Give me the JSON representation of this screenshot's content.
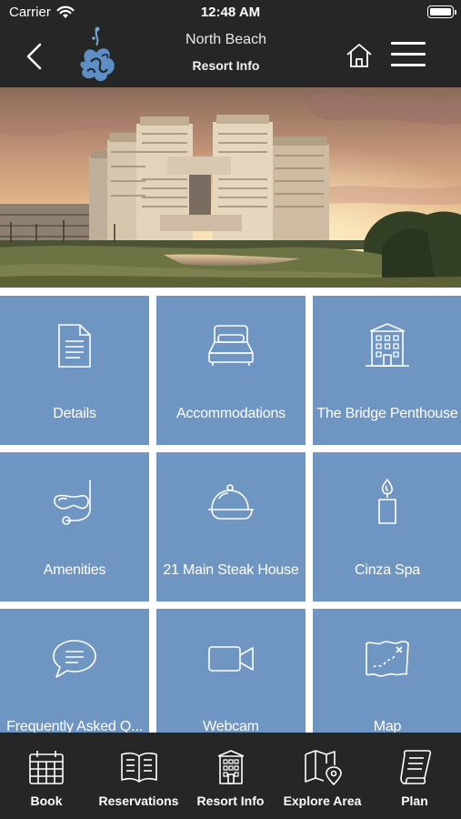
{
  "status_bar": {
    "carrier": "Carrier",
    "time": "12:48 AM"
  },
  "nav": {
    "title": "North Beach",
    "subtitle": "Resort Info",
    "icons": [
      "back-chevron-icon",
      "resort-logo",
      "home-icon",
      "hamburger-menu-icon"
    ]
  },
  "hero": {
    "description_icon": "resort-photo"
  },
  "tiles": [
    {
      "label": "Details",
      "icon": "document-icon"
    },
    {
      "label": "Accommodations",
      "icon": "bed-icon"
    },
    {
      "label": "The Bridge Penthouse",
      "icon": "building-icon"
    },
    {
      "label": "Amenities",
      "icon": "snorkel-mask-icon"
    },
    {
      "label": "21 Main Steak House",
      "icon": "cloche-icon"
    },
    {
      "label": "Cinza Spa",
      "icon": "candle-icon"
    },
    {
      "label": "Frequently Asked Q...",
      "icon": "chat-bubble-icon"
    },
    {
      "label": "Webcam",
      "icon": "video-camera-icon"
    },
    {
      "label": "Map",
      "icon": "treasure-map-icon"
    }
  ],
  "tab_bar": [
    {
      "label": "Book",
      "icon": "calendar-icon"
    },
    {
      "label": "Reservations",
      "icon": "open-book-icon"
    },
    {
      "label": "Resort Info",
      "icon": "building-icon"
    },
    {
      "label": "Explore Area",
      "icon": "map-pin-icon"
    },
    {
      "label": "Plan",
      "icon": "scroll-icon"
    }
  ],
  "colors": {
    "bar_background": "#262626",
    "tile_background": "#6f95c2",
    "text": "#ffffff"
  }
}
